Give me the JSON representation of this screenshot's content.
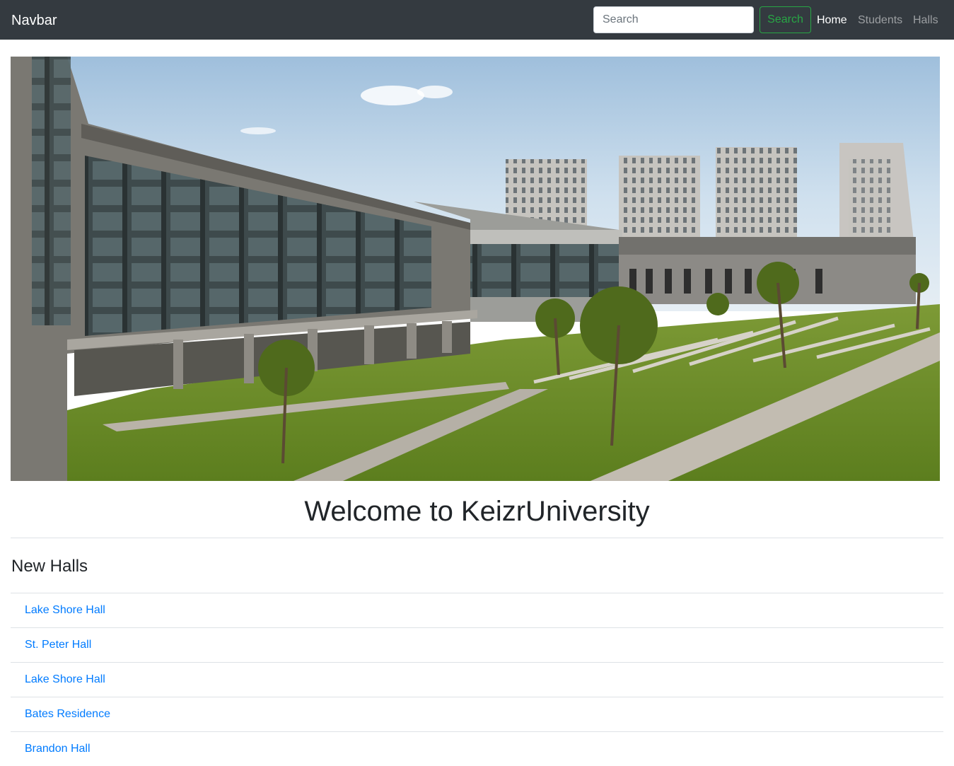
{
  "navbar": {
    "brand": "Navbar",
    "search": {
      "placeholder": "Search",
      "button_label": "Search"
    },
    "links": [
      {
        "label": "Home",
        "active": true
      },
      {
        "label": "Students",
        "active": false
      },
      {
        "label": "Halls",
        "active": false
      }
    ]
  },
  "main": {
    "welcome": "Welcome to KeizrUniversity",
    "section_title": "New Halls",
    "halls": [
      {
        "name": "Lake Shore Hall"
      },
      {
        "name": "St. Peter Hall"
      },
      {
        "name": "Lake Shore Hall"
      },
      {
        "name": "Bates Residence"
      },
      {
        "name": "Brandon Hall"
      }
    ]
  },
  "colors": {
    "navbar_bg": "#343a40",
    "search_button": "#28a745",
    "link": "#007bff",
    "divider": "#dee2e6"
  }
}
